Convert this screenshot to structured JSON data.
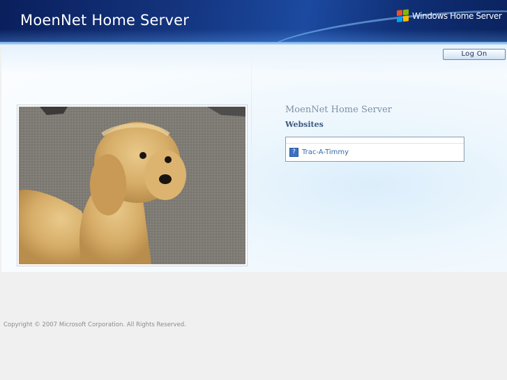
{
  "header": {
    "title": "MoenNet Home Server",
    "brand_logo_text": "Windows Home Server",
    "brand_logo_icon": "windows-flag-icon"
  },
  "toolbar": {
    "logon_label": "Log On"
  },
  "main": {
    "photo_description_icon": "dog-photo",
    "section_title": "MoenNet Home Server",
    "websites_heading": "Websites",
    "websites": [
      {
        "label": "Trac-A-Timmy",
        "icon": "help-page-icon",
        "icon_glyph": "?"
      }
    ]
  },
  "footer": {
    "copyright": "Copyright © 2007 Microsoft Corporation. All Rights Reserved."
  },
  "colors": {
    "header_bg": "#14347e",
    "accent": "#3a68a8",
    "footer_bg": "#f0f0f0"
  }
}
